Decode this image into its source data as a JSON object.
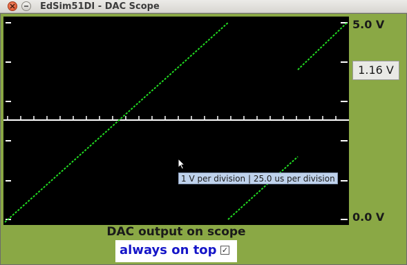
{
  "window": {
    "title": "EdSim51DI - DAC Scope"
  },
  "scope": {
    "max_label": "5.0 V",
    "min_label": "0.0 V",
    "current_value": "1.16 V",
    "tooltip": "1 V per division | 25.0 us per division",
    "trace_color": "#22dd22",
    "background": "#000000"
  },
  "footer": {
    "caption": "DAC output on scope",
    "always_on_top_label": "always on top",
    "always_on_top_checked": true
  },
  "colors": {
    "panel": "#8aa845",
    "link_text": "#1515c8"
  }
}
